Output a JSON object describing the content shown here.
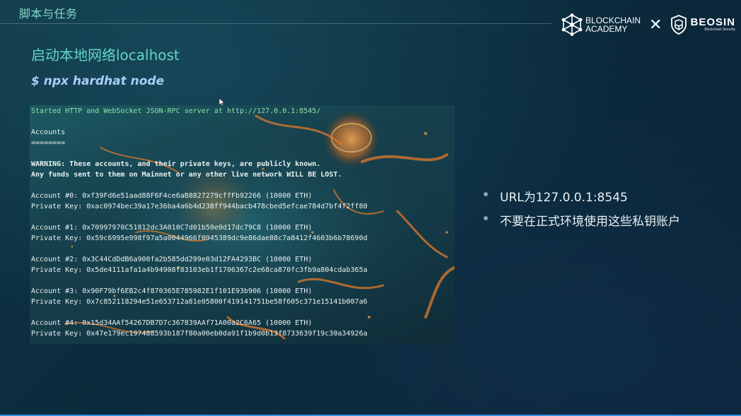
{
  "header": {
    "section_title": "脚本与任务"
  },
  "logos": {
    "blockchain_academy_line1": "BLOCKCHAIN",
    "blockchain_academy_line2": "ACADEMY",
    "times_symbol": "✕",
    "beosin_name": "BEOSIN",
    "beosin_sub": "Blockchain Security",
    "blockchain_icon": "hexagon-network-icon",
    "beosin_icon": "shield-icon"
  },
  "main": {
    "heading": "启动本地网络localhost",
    "command": "$ npx hardhat node"
  },
  "terminal": {
    "lines": [
      "Started HTTP and WebSocket JSON-RPC server at http://127.0.0.1:8545/",
      "",
      "Accounts",
      "========",
      "",
      "WARNING: These accounts, and their private keys, are publicly known.",
      "Any funds sent to them on Mainnet or any other live network WILL BE LOST.",
      "",
      "Account #0: 0xf39Fd6e51aad88F6F4ce6aB8827279cffFb92266 (10000 ETH)",
      "Private Key: 0xac0974bec39a17e36ba4a6b4d238ff944bacb478cbed5efcae784d7bf4f2ff80",
      "",
      "Account #1: 0x70997970C51812dc3A010C7d01b50e0d17dc79C8 (10000 ETH)",
      "Private Key: 0x59c6995e998f97a5a0044966f0945389dc9e86dae88c7a8412f4603b6b78690d",
      "",
      "Account #2: 0x3C44CdDdB6a900fa2b585dd299e03d12FA4293BC (10000 ETH)",
      "Private Key: 0x5de4111afa1a4b94908f83103eb1f1706367c2e68ca870fc3fb9a804cdab365a",
      "",
      "Account #3: 0x90F79bf6EB2c4f870365E785982E1f101E93b906 (10000 ETH)",
      "Private Key: 0x7c852118294e51e653712a81e05800f419141751be58f605c371e15141b007a6",
      "",
      "Account #4: 0x15d34AAf54267DB7D7c367839AAf71A00a2C6A65 (10000 ETH)",
      "Private Key: 0x47e179ec197488593b187f80a00eb0da91f1b9d0b13f8733639f19c30a34926a"
    ]
  },
  "bullets": [
    "URL为127.0.0.1:8545",
    "不要在正式环境使用这些私钥账户"
  ],
  "colors": {
    "accent_teal": "#63d4c3",
    "command_blue": "#a9cdfb",
    "bottom_bar": "#2f8fe0"
  }
}
